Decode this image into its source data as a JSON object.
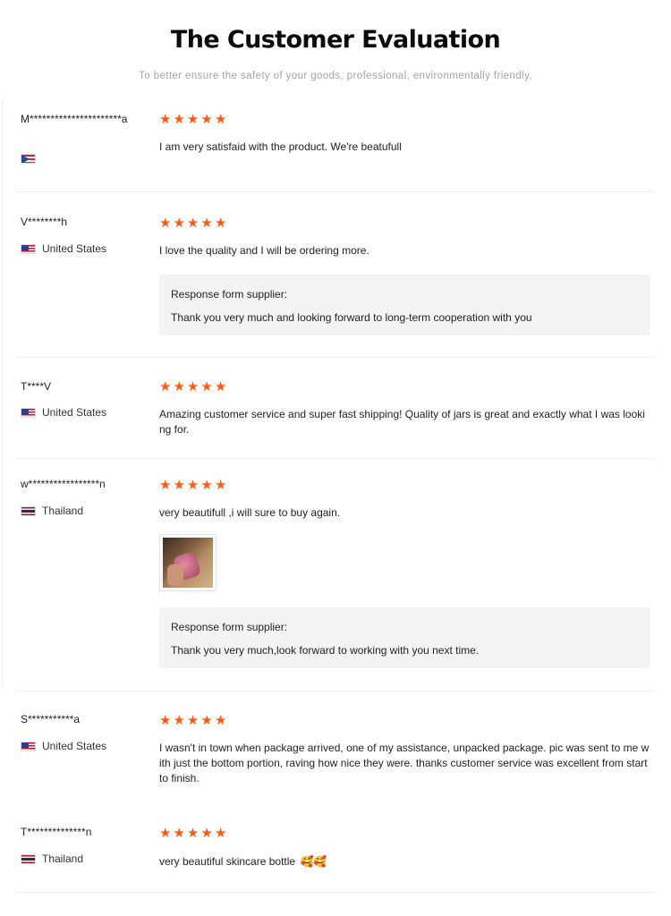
{
  "header": {
    "title": "The Customer Evaluation",
    "subtitle": "To better ensure the safety of your goods, professional, environmentally friendly,"
  },
  "star_color": "#ff5a12",
  "reviews": [
    {
      "user": "M**********************a",
      "country": "",
      "flag": "puerto-rico-flag-icon",
      "rating": 5,
      "comment": "I am very satisfaid with the product. We're beatufull"
    },
    {
      "user": "V********h",
      "country": "United States",
      "flag": "us-flag-icon",
      "rating": 5,
      "comment": "I love the quality and I will be ordering more.",
      "response_label": "Response form supplier:",
      "response_text": "Thank you very much and looking forward to long-term cooperation with you"
    },
    {
      "user": "T****V",
      "country": "United States",
      "flag": "us-flag-icon",
      "rating": 5,
      "comment": "Amazing customer service and super fast shipping! Quality of jars is great and exactly what I was looking for."
    },
    {
      "user": "w*****************n",
      "country": "Thailand",
      "flag": "thailand-flag-icon",
      "rating": 5,
      "comment": "very beautifull ,i will sure to buy again.",
      "photo": "review-photo-thumbnail",
      "response_label": "Response form supplier:",
      "response_text": "Thank you very much,look forward to working with you next time."
    },
    {
      "user": "S***********a",
      "country": "United States",
      "flag": "us-flag-icon",
      "rating": 5,
      "comment": "I wasn't in town when package arrived, one of my assistance, unpacked package. pic was sent to me with just the bottom portion, raving how nice they were. thanks customer service was excellent from start to finish."
    },
    {
      "user": "T**************n",
      "country": "Thailand",
      "flag": "thailand-flag-icon",
      "rating": 5,
      "comment": "very beautiful skincare bottle",
      "emoji": "🥰🥰"
    }
  ]
}
